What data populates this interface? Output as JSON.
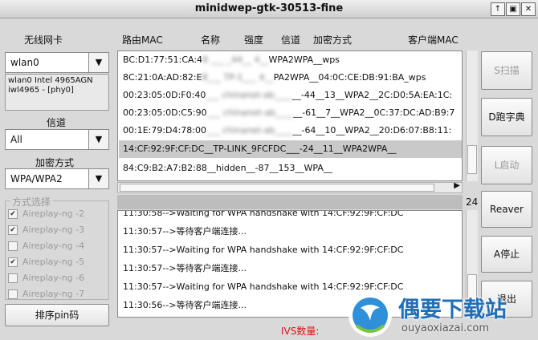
{
  "window": {
    "title": "minidwep-gtk-30513-fine",
    "controls": [
      "↑",
      "▣",
      "✕"
    ]
  },
  "left": {
    "iface_label": "无线网卡",
    "iface_value": "wlan0",
    "iface_info_line1": "wlan0 Intel 4965AGN",
    "iface_info_line2": "iwl4965 - [phy0]",
    "channel_label": "信道",
    "channel_value": "All",
    "encrypt_label": "加密方式",
    "encrypt_value": "WPA/WPA2",
    "method_legend": "方式选择",
    "methods": [
      {
        "label": "Aireplay-ng -2",
        "checked": true
      },
      {
        "label": "Aireplay-ng -3",
        "checked": true
      },
      {
        "label": "Aireplay-ng -4",
        "checked": false
      },
      {
        "label": "Aireplay-ng -5",
        "checked": true
      },
      {
        "label": "Aireplay-ng -6",
        "checked": false
      },
      {
        "label": "Aireplay-ng -7",
        "checked": false
      }
    ],
    "sort_pin_button": "排序pin码"
  },
  "table": {
    "headers": [
      "路由MAC",
      "名称",
      "强度",
      "信道",
      "加密方式",
      "客户端MAC"
    ],
    "rows": [
      {
        "pre": "BC:D1:77:51:CA:4",
        "blur": "8  ___  _44__  4__",
        "post": "WPA2WPA__wps"
      },
      {
        "pre": "8C:21:0A:AD:82:E",
        "blur": "8___ TP-1___  4__",
        "post": "PA2WPA__04:0C:CE:DB:91:BA_wps"
      },
      {
        "pre": "00:23:05:0D:F0:40",
        "blur": "___ chinanet-ab____",
        "post": "__-44__13__WPA2__2C:D0:5A:EA:1C:"
      },
      {
        "pre": "00:23:05:0D:C5:90",
        "blur": "___ chinanet-ab____",
        "post": "__-61__7__WPA2__0C:37:DC:AD:B9:7"
      },
      {
        "pre": "00:1E:79:D4:78:00",
        "blur": "___ chinanet-ab____",
        "post": "__-64__10__WPA2__20:D6:07:B8:11:"
      },
      {
        "pre": "14:CF:92:9F:CF:DC__TP-LINK_9FCFDC___-24__11__WPA2WPA__",
        "blur": "",
        "post": ""
      },
      {
        "pre": "84:C9:B2:A7:B2:88__hidden__-87__153__WPA__",
        "blur": "",
        "post": ""
      }
    ],
    "selected_index": 5,
    "count": "24"
  },
  "log": {
    "lines": [
      "11:30:58-->Waiting for WPA handshake with 14:CF:92:9F:CF:DC",
      "11:30:57-->等待客户端连接...",
      "11:30:57-->Waiting for WPA handshake with 14:CF:92:9F:CF:DC",
      "11:30:57-->Waiting for WPA handshake with 14:CF:92:9F:CF:DC",
      "11:30:56-->等待客户端连接..."
    ],
    "ivs_label": "IVS数量:"
  },
  "buttons": {
    "scan": "S扫描",
    "dict": "D跑字典",
    "start": "L启动",
    "reaver": "Reaver",
    "stop": "A停止",
    "exit": "退出"
  },
  "watermark": {
    "text": "偶要下载站",
    "url": "ouyaoxiazai.com"
  }
}
